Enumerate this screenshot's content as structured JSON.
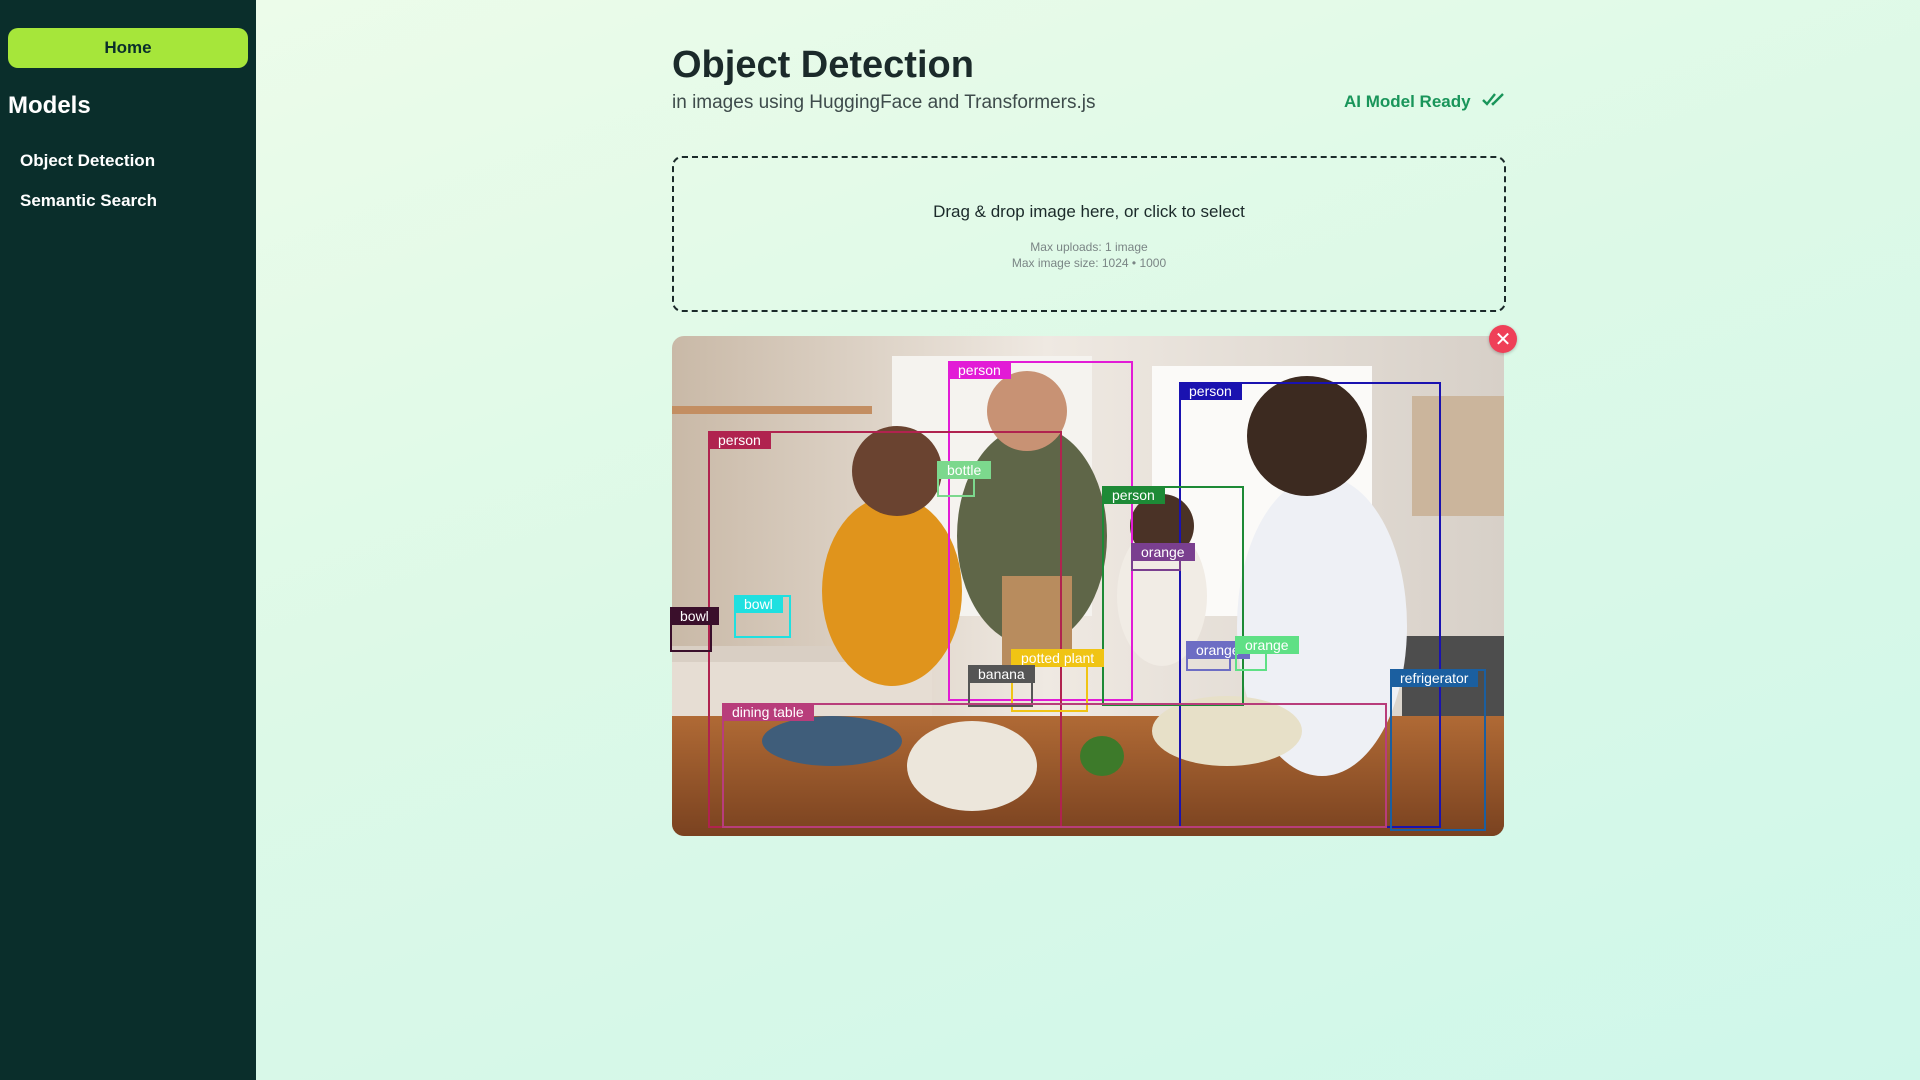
{
  "sidebar": {
    "home_label": "Home",
    "models_title": "Models",
    "items": [
      {
        "label": "Object Detection"
      },
      {
        "label": "Semantic Search"
      }
    ]
  },
  "header": {
    "title": "Object Detection",
    "subtitle": "in images using HuggingFace and Transformers.js",
    "status": "AI Model Ready"
  },
  "dropzone": {
    "prompt": "Drag & drop image here, or click to select",
    "max_uploads": "Max uploads: 1 image",
    "max_size": "Max image size: 1024 • 1000"
  },
  "detections": [
    {
      "label": "person",
      "color": "#e21bd6"
    },
    {
      "label": "person",
      "color": "#1a12b0"
    },
    {
      "label": "person",
      "color": "#b0234f"
    },
    {
      "label": "bottle",
      "color": "#7cd88d"
    },
    {
      "label": "person",
      "color": "#1d8a36"
    },
    {
      "label": "orange",
      "color": "#7a3f8f"
    },
    {
      "label": "bowl",
      "color": "#3a0f2b"
    },
    {
      "label": "bowl",
      "color": "#1fe0e0"
    },
    {
      "label": "orange",
      "color": "#6d6dc4"
    },
    {
      "label": "orange",
      "color": "#5fe085"
    },
    {
      "label": "potted plant",
      "color": "#f0c414"
    },
    {
      "label": "banana",
      "color": "#555555"
    },
    {
      "label": "refrigerator",
      "color": "#1b5fa0"
    },
    {
      "label": "dining table",
      "color": "#b83d7b"
    }
  ],
  "colors": {
    "sidebar_bg": "#0a2e2b",
    "accent": "#a6e63a",
    "ready_green": "#19955a",
    "close_red": "#ef4058"
  }
}
